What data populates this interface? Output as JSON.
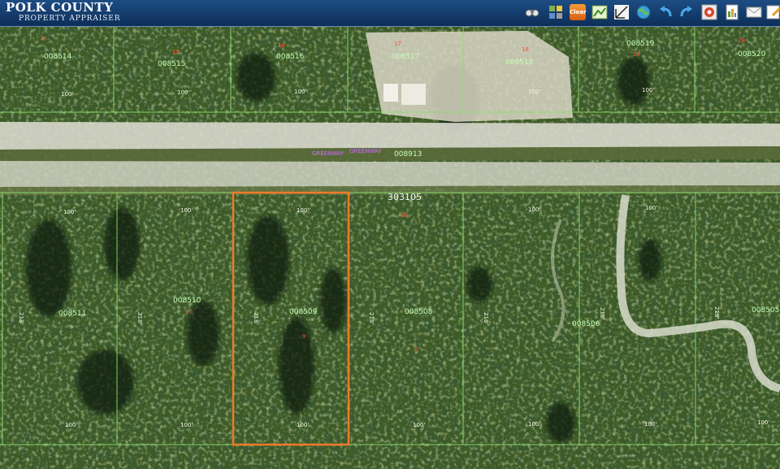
{
  "header": {
    "title": "POLK COUNTY",
    "subtitle": "PROPERTY APPRAISER",
    "tools": [
      {
        "name": "binoculars-icon",
        "label": ""
      },
      {
        "name": "layers-icon",
        "label": ""
      },
      {
        "name": "clear-icon",
        "label": "Clear"
      },
      {
        "name": "map-view-icon",
        "label": ""
      },
      {
        "name": "measure-icon",
        "label": ""
      },
      {
        "name": "globe-icon",
        "label": ""
      },
      {
        "name": "undo-icon",
        "label": ""
      },
      {
        "name": "redo-icon",
        "label": ""
      },
      {
        "name": "identify-icon",
        "label": ""
      },
      {
        "name": "report-icon",
        "label": ""
      },
      {
        "name": "email-icon",
        "label": ""
      },
      {
        "name": "edit-icon",
        "label": ""
      }
    ]
  },
  "map": {
    "top_parcels": [
      "008514",
      "008515",
      "008516",
      "008517",
      "008518",
      "008519",
      "008520"
    ],
    "road_parcel": "008913",
    "road_labels": [
      "GREENWAY",
      "GREENWAY"
    ],
    "subdivision_id": "303105",
    "lot_number": "85",
    "bottom_parcels": [
      "008511",
      "008510",
      "008509",
      "008508",
      "008506",
      "008505"
    ],
    "lot_numbers": [
      "8",
      "15",
      "16",
      "17",
      "18",
      "19",
      "20",
      "10",
      "9",
      "6"
    ],
    "dimension_front": "100'",
    "dimension_side": "218'",
    "selected_parcel": "008509",
    "colors": {
      "selection": "#f07a2a",
      "lot_lines": "#8de06b",
      "header": "#153d6e"
    }
  }
}
